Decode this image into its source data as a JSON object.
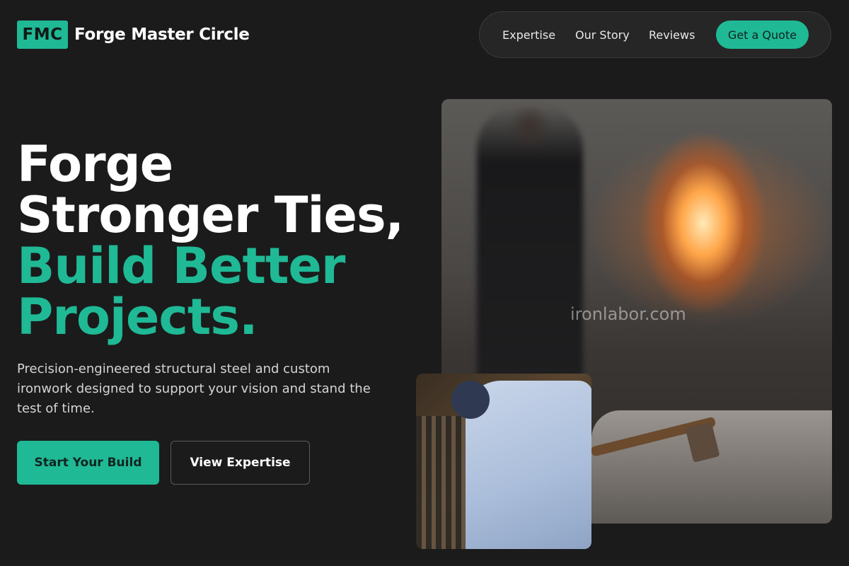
{
  "brand": {
    "mark": "FMC",
    "name": "Forge Master Circle"
  },
  "nav": {
    "links": [
      "Expertise",
      "Our Story",
      "Reviews"
    ],
    "cta": "Get a Quote"
  },
  "hero": {
    "title_line1": "Forge",
    "title_line2": "Stronger Ties,",
    "title_line3": "Build Better",
    "title_line4": "Projects.",
    "subtitle": "Precision-engineered structural steel and custom ironwork designed to support your vision and stand the test of time.",
    "primary_button": "Start Your Build",
    "secondary_button": "View Expertise"
  },
  "images": {
    "main_watermark": "ironlabor.com"
  },
  "colors": {
    "accent": "#1fb995",
    "background": "#1b1b1c",
    "nav_bg": "#262627"
  }
}
